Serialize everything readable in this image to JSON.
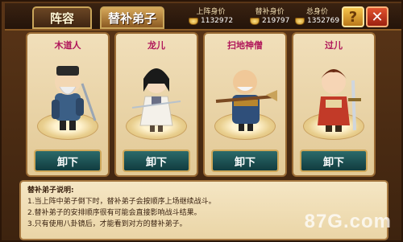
{
  "tabs": [
    {
      "label": "阵容",
      "active": false
    },
    {
      "label": "替补弟子",
      "active": true
    }
  ],
  "stats": [
    {
      "label": "上阵身价",
      "value": "1132972",
      "icon": "gold-ingot-icon"
    },
    {
      "label": "替补身价",
      "value": "219797",
      "icon": "gold-ingot-icon"
    },
    {
      "label": "总身价",
      "value": "1352769",
      "icon": "gold-ingot-icon"
    }
  ],
  "buttons": {
    "help": "?",
    "close": "✕"
  },
  "cards": [
    {
      "name": "木道人",
      "action": "卸下"
    },
    {
      "name": "龙儿",
      "action": "卸下"
    },
    {
      "name": "扫地神僧",
      "action": "卸下"
    },
    {
      "name": "过儿",
      "action": "卸下"
    }
  ],
  "info": {
    "title": "替补弟子说明:",
    "lines": [
      "1.当上阵中弟子倒下时，替补弟子会按顺序上场继续战斗。",
      "2.替补弟子的安排顺序很有可能会直接影响战斗结果。",
      "3.只有使用八卦镜后，才能看到对方的替补弟子。"
    ]
  },
  "watermark": "87G.com",
  "colors": {
    "name_text": "#b0165a",
    "button_bg": "#1f5356",
    "gold": "#e2b64a"
  }
}
